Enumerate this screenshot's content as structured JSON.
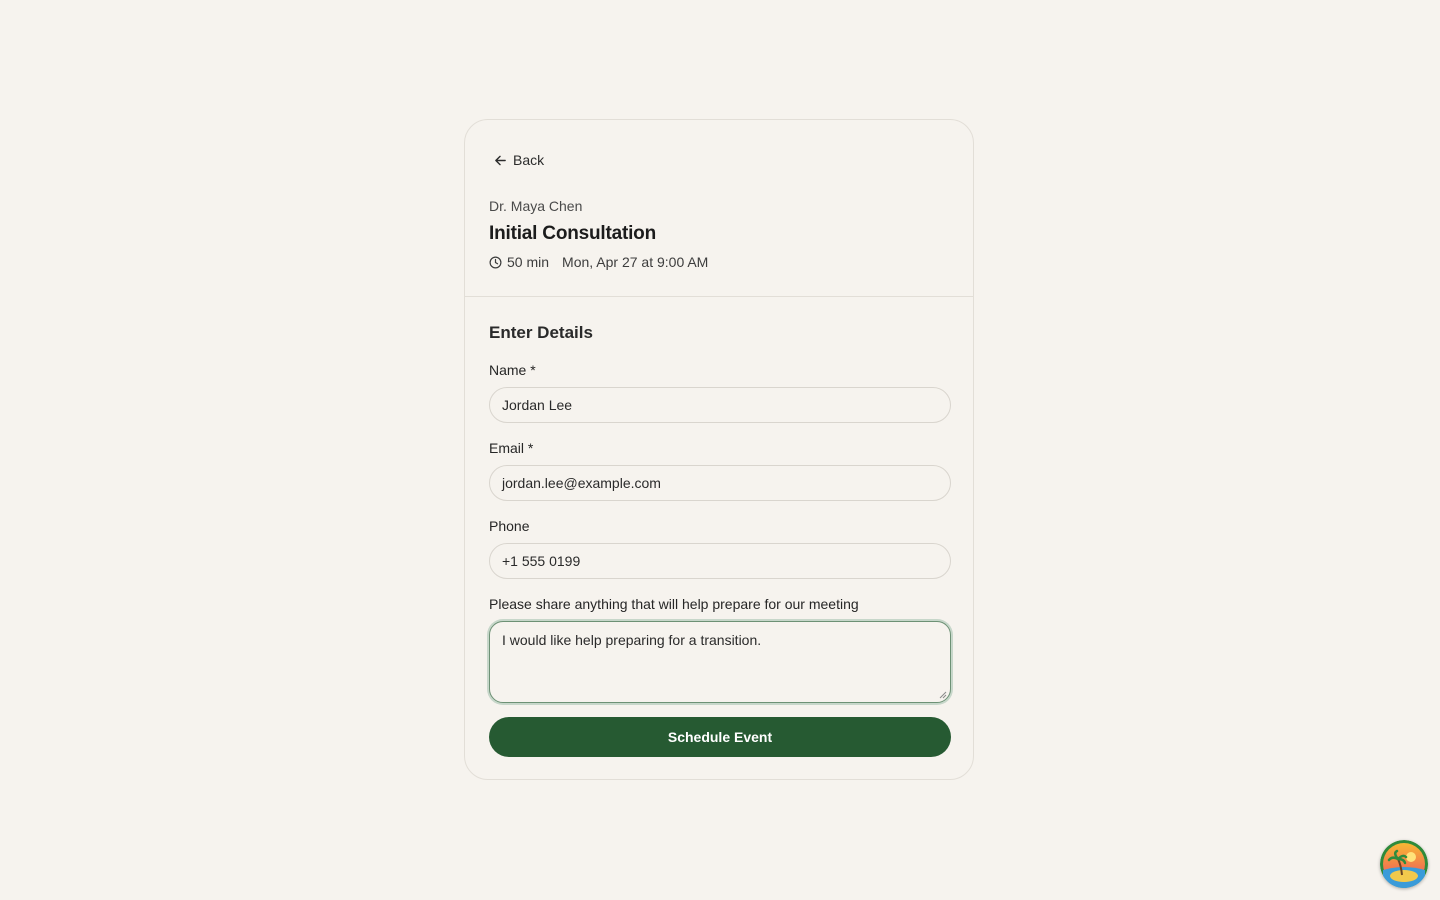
{
  "header": {
    "back_label": "Back",
    "host_name": "Dr. Maya Chen",
    "event_title": "Initial Consultation",
    "duration": "50 min",
    "datetime": "Mon, Apr 27 at 9:00 AM"
  },
  "form": {
    "section_title": "Enter Details",
    "name_label": "Name *",
    "name_value": "Jordan Lee",
    "email_label": "Email *",
    "email_value": "jordan.lee@example.com",
    "phone_label": "Phone",
    "phone_value": "+1 555 0199",
    "notes_label": "Please share anything that will help prepare for our meeting",
    "notes_value": "I would like help preparing for a transition.",
    "submit_label": "Schedule Event"
  },
  "colors": {
    "background": "#f6f3ee",
    "accent": "#265a32",
    "focus_ring": "#6d9175"
  },
  "icons": {
    "back": "arrow-left-icon",
    "duration": "clock-icon",
    "avatar": "palm-island-avatar"
  }
}
